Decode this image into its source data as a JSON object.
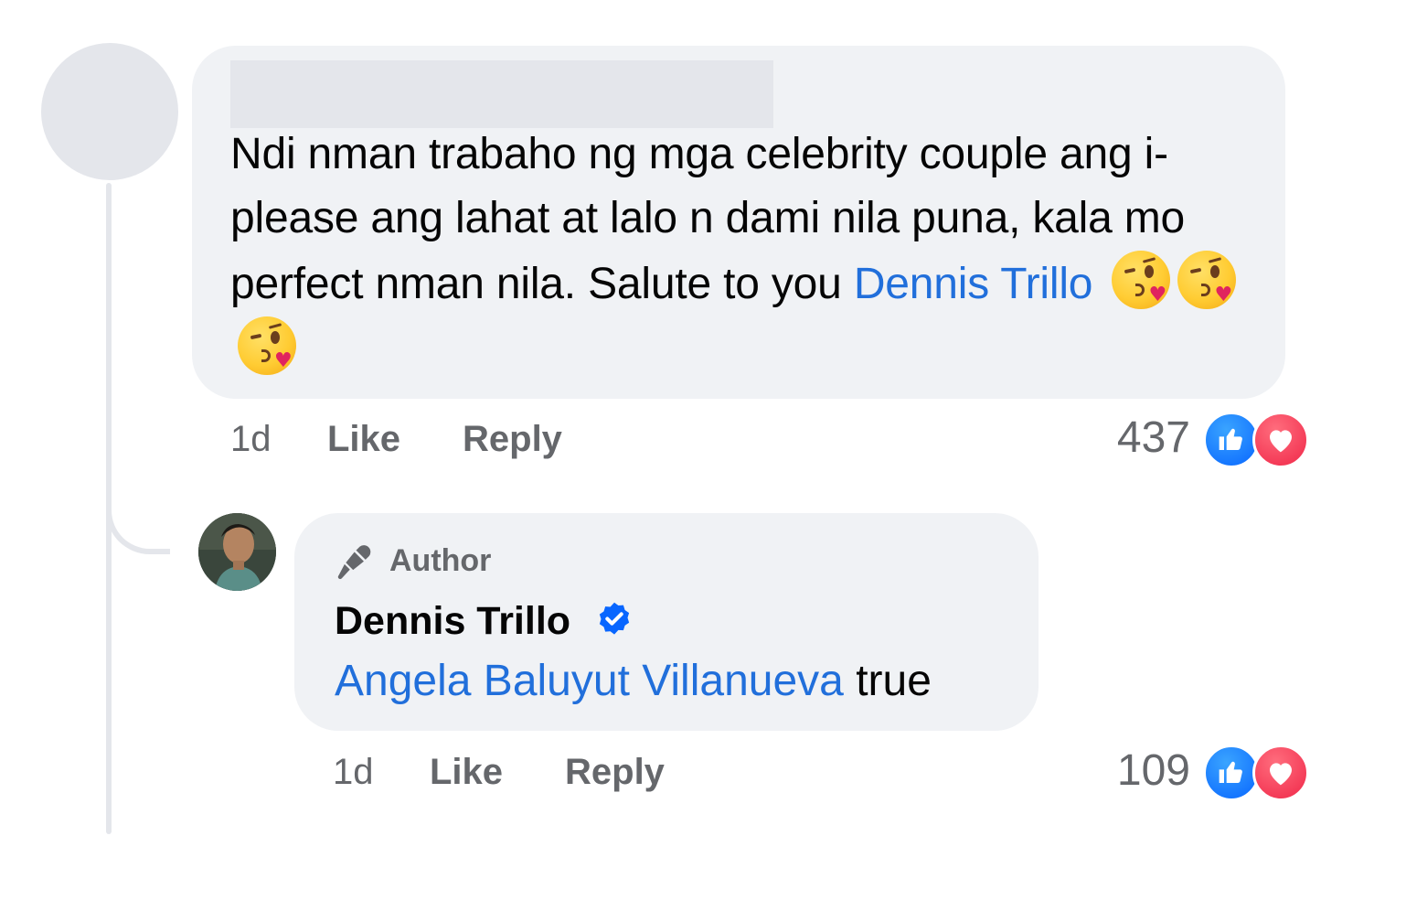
{
  "comment": {
    "author_name": "",
    "text": "Ndi nman trabaho ng mga celebrity couple ang i-please ang lahat at lalo n dami nila puna, kala mo perfect nman nila. Salute to you",
    "mention": "Dennis Trillo",
    "emojis": [
      "kissing-heart-emoji",
      "kissing-heart-emoji",
      "kissing-heart-emoji"
    ],
    "time": "1d",
    "like_label": "Like",
    "reply_label": "Reply",
    "reaction_count": "437",
    "reactions": [
      "like-icon",
      "love-icon"
    ]
  },
  "reply": {
    "badge_label": "Author",
    "badge_icon": "microphone-icon",
    "author_name": "Dennis Trillo",
    "verified": true,
    "mention": "Angela Baluyut Villanueva",
    "text": "true",
    "time": "1d",
    "like_label": "Like",
    "reply_label": "Reply",
    "reaction_count": "109",
    "reactions": [
      "like-icon",
      "love-icon"
    ]
  },
  "colors": {
    "bubble": "#f0f2f5",
    "mention": "#216fdb",
    "meta": "#65676b",
    "like": "#0866ff",
    "love": "#f02849",
    "verified": "#0866ff"
  }
}
